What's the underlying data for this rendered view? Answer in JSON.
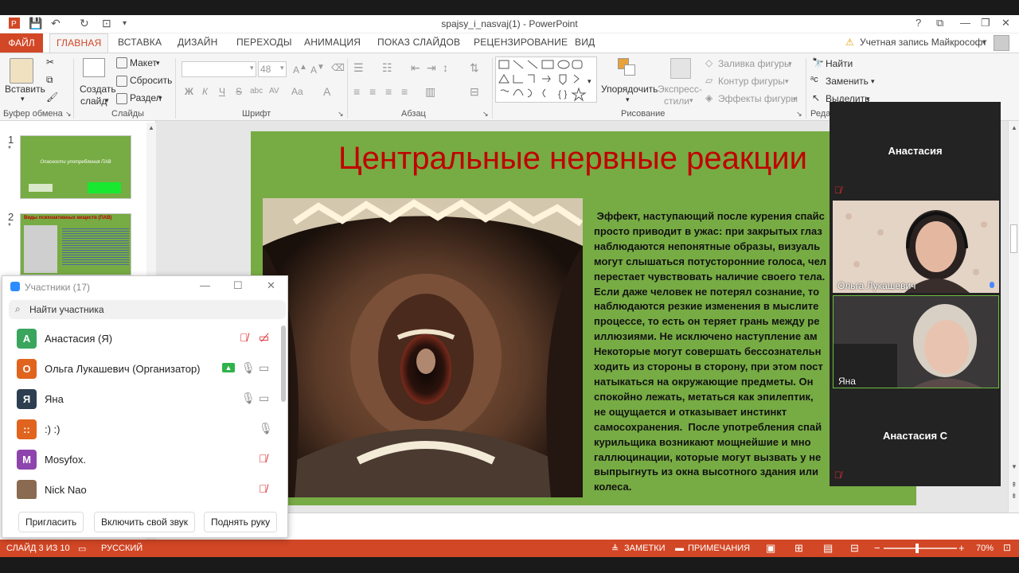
{
  "window": {
    "title": "spajsy_i_nasvaj(1) - PowerPoint",
    "help": "?",
    "account": "Учетная запись Майкрософт"
  },
  "tabs": [
    "ФАЙЛ",
    "ГЛАВНАЯ",
    "ВСТАВКА",
    "ДИЗАЙН",
    "ПЕРЕХОДЫ",
    "АНИМАЦИЯ",
    "ПОКАЗ СЛАЙДОВ",
    "РЕЦЕНЗИРОВАНИЕ",
    "ВИД"
  ],
  "ribbon": {
    "clipboard": {
      "paste": "Вставить",
      "group": "Буфер обмена"
    },
    "slides": {
      "new_slide_line1": "Создать",
      "new_slide_line2": "слайд",
      "layout": "Макет",
      "reset": "Сбросить",
      "section": "Раздел",
      "group": "Слайды"
    },
    "font": {
      "size": "48",
      "bold": "Ж",
      "italic": "К",
      "underline": "Ч",
      "strike": "S",
      "shadow": "abc",
      "spacing": "AV",
      "case": "Aa",
      "color": "A",
      "group": "Шрифт"
    },
    "paragraph": {
      "group": "Абзац"
    },
    "drawing": {
      "arrange": "Упорядочить",
      "quick_styles_line1": "Экспресс-",
      "quick_styles_line2": "стили",
      "fill": "Заливка фигуры",
      "outline": "Контур фигуры",
      "effects": "Эффекты фигуры",
      "group": "Рисование"
    },
    "editing": {
      "find": "Найти",
      "replace": "Заменить",
      "select": "Выделить",
      "group": "Реда"
    }
  },
  "thumbnails": [
    {
      "num": "1",
      "star": "*",
      "title": "Опасности употребления ПАВ"
    },
    {
      "num": "2",
      "star": "*",
      "title": "Виды психоактивных веществ (ПАВ)"
    }
  ],
  "slide": {
    "title": "Центральные нервные реакции",
    "body": " Эффект, наступающий после курения спайс\nпросто приводит в ужас: при закрытых глаз\nнаблюдаются непонятные образы, визуаль\nмогут слышаться потусторонние голоса, чел\nперестает чувствовать наличие своего тела.\nЕсли даже человек не потерял сознание, то\nнаблюдаются резкие изменения в мыслите\nпроцессе, то есть он теряет грань между ре\nиллюзиями. Не исключено наступление ам\nНекоторые могут совершать бессознательн\nходить из стороны в сторону, при этом пост\nнатыкаться на окружающие предметы. Он\nспокойно лежать, метаться как эпилептик, \nне ощущается и отказывает инстинкт\nсамосохранения.  После употребления спай\nкурильщика возникают мощнейшие и мно\nгаллюцинации, которые могут вызвать у не\nвыпрыгнуть из окна высотного здания или\nколеса."
  },
  "statusbar": {
    "slide_info": "СЛАЙД 3 ИЗ 10",
    "language": "РУССКИЙ",
    "notes": "ЗАМЕТКИ",
    "comments": "ПРИМЕЧАНИЯ",
    "zoom": "70%",
    "zoom_level": 0.45
  },
  "video_panel": {
    "tiles": [
      {
        "name": "Анастасия",
        "muted": true,
        "video": false
      },
      {
        "name": "Ольга Лукашевич",
        "muted": false,
        "video": true
      },
      {
        "name": "Яна",
        "muted": false,
        "video": true
      },
      {
        "name": "Анастасия С",
        "muted": true,
        "video": false
      }
    ]
  },
  "participants": {
    "title": "Участники (17)",
    "search_placeholder": "Найти участника",
    "list": [
      {
        "initial": "А",
        "name": "Анастасия (Я)",
        "color": "#3aa55d"
      },
      {
        "initial": "О",
        "name": "Ольга Лукашевич (Организатор)",
        "color": "#e0641d"
      },
      {
        "initial": "Я",
        "name": "Яна",
        "color": "#2c3e50"
      },
      {
        "initial": "::",
        "name": ":) :)",
        "color": "#e0641d"
      },
      {
        "initial": "M",
        "name": "Mosyfox.",
        "color": "#8e44ad"
      },
      {
        "initial": "",
        "name": "Nick Nao",
        "color": "#8a6a50"
      }
    ],
    "invite": "Пригласить",
    "unmute": "Включить свой звук",
    "raise_hand": "Поднять руку"
  },
  "colors": {
    "accent": "#d24726",
    "slide_bg": "#77ab44",
    "title_red": "#c00000"
  }
}
